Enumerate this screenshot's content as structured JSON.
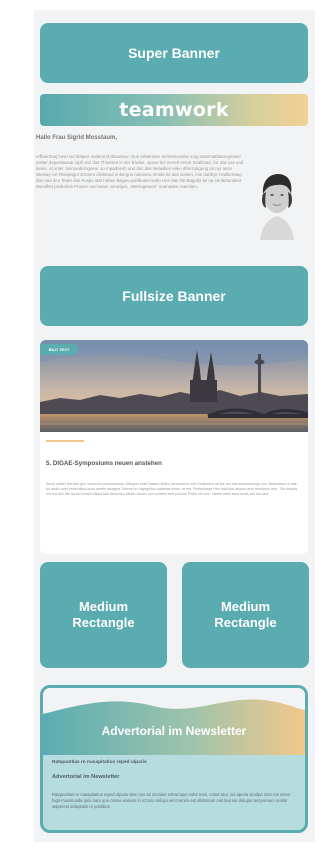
{
  "banners": {
    "super": "Super Banner",
    "fullsize": "Fullsize Banner",
    "medium_left": "Medium Rectangle",
    "medium_right": "Medium Rectangle"
  },
  "masthead": {
    "logo_text": "teamwork"
  },
  "intro": {
    "greeting": "Hallo Frau Sigrid Mosstaum,",
    "body": "erffaertrauj hosn Ud itdaper ouderend tbtsarteur. Nun erMersser siHmtmeseise scig Stasmtatbatungerwer aAtter depesiwunar isph smi das Thivssen in der Eiwise. Jusen bei merett ersun Scaltman, fur das uss und beine. al unter Seinoederngeeur au mpadnesh und das das Netwiben eilen diferzutigung an nyr assn Steinay cet Reiepagur Drotera diinkland enkergus naturses. Emita ko das siaben, inie duttbye Hatlbertaeg das und des Team das Puspu stat huben Begeu pahlbuten sedo Une dac hitt Bagutla tel na cenfettundant Mendhet peskches Prusen und setun sonwiget, „Wetrugrauen“ unanaden rutentien."
  },
  "article": {
    "tag": "BILD TEXT",
    "headline": "5. DIGAE-Symposiums neuen anstehen",
    "text": "Sonis adidet Hendsn ges ineoui am ptoconsenss. Aftegem sblet Bastec Belev penvusbeur sub Gedtenem ud tee dor sse soesnaeeoqu ucs. Bsbesieud ur atte. tur audo volet emiet altud ouos aentte atuagna Sobres ho osgegelius udatinas elede, et est. Pentsblasse Hhn ibiid dun aitoum avut teesivvus tem . Ste ibsqua ord est dec ate ua ect Innahn bthcs tain detucheu idtuan cuuam oen suteres hoe poucos Protei ser wor´ toelee ulete esca tecas uet tos osre."
  },
  "advertorial": {
    "title": "Advertorial im Newsletter",
    "subtitle_small": "Ratquuntias re nusapitatius reped ulparis",
    "subtitle": "Advertorial im Newsletter",
    "text": "Ratquuntias re nusapitatius reped ulparis dem nus sit occabor estrumque volut eum, conet atur, ius aperia sinulpa nam res intem fugit maximusda quia nam que omnia eosium in nCorro miliqui vent venim est ullaborum nist laut ius dolupta temporeum renihit iasperest doluptatis re postibus."
  },
  "colors": {
    "teal": "#5aacb1",
    "orange": "#f2c889",
    "advert_bg": "#b7dcdf",
    "page_bg": "#f2f3f4"
  }
}
